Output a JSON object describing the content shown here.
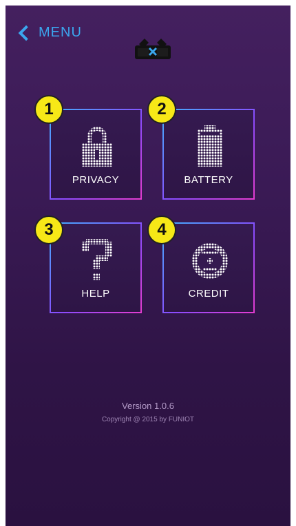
{
  "nav": {
    "back_label": "MENU",
    "back_icon": "chevron-left-icon",
    "accent": "#3ba6ee"
  },
  "logo": {
    "icon": "glasses-close-icon"
  },
  "tiles": [
    {
      "number": "1",
      "label": "PRIVACY",
      "icon": "lock-icon"
    },
    {
      "number": "2",
      "label": "BATTERY",
      "icon": "battery-icon"
    },
    {
      "number": "3",
      "label": "HELP",
      "icon": "question-mark-icon"
    },
    {
      "number": "4",
      "label": "CREDIT",
      "icon": "smiley-face-icon"
    }
  ],
  "footer": {
    "version": "Version 1.0.6",
    "copyright": "Copyright @ 2015 by FUNIOT"
  },
  "colors": {
    "badge": "#f7e817",
    "tile_border_start": "#3fb3ff",
    "tile_border_end": "#e63cd0"
  }
}
